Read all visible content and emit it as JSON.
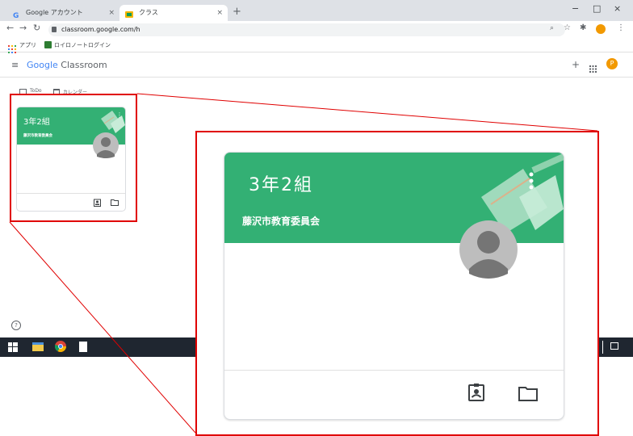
{
  "browser": {
    "tabs": [
      {
        "label": "Google アカウント",
        "close": "×",
        "active": false
      },
      {
        "label": "クラス",
        "close": "×",
        "active": true
      }
    ],
    "new_tab": "+",
    "window_controls": [
      "−",
      "□",
      "×"
    ],
    "url": "classroom.google.com/h",
    "bookmarks": [
      {
        "label": "アプリ"
      },
      {
        "label": "ロイロノートログイン"
      }
    ],
    "toolbar_icons": [
      "zoom-icon",
      "star-icon",
      "extensions-icon",
      "profile-avatar",
      "menu-icon"
    ]
  },
  "app": {
    "logo_google": "Google",
    "logo_classroom": " Classroom",
    "avatar_letter": "P",
    "nav": [
      {
        "label": "ToDo",
        "icon": "todo-icon"
      },
      {
        "label": "カレンダー",
        "icon": "calendar-icon"
      }
    ]
  },
  "class_card": {
    "name": "3年2組",
    "section": "藤沢市教育委員会",
    "banner_color": "#33b074",
    "highlight_color": "#e00000"
  },
  "help_icon": "?"
}
